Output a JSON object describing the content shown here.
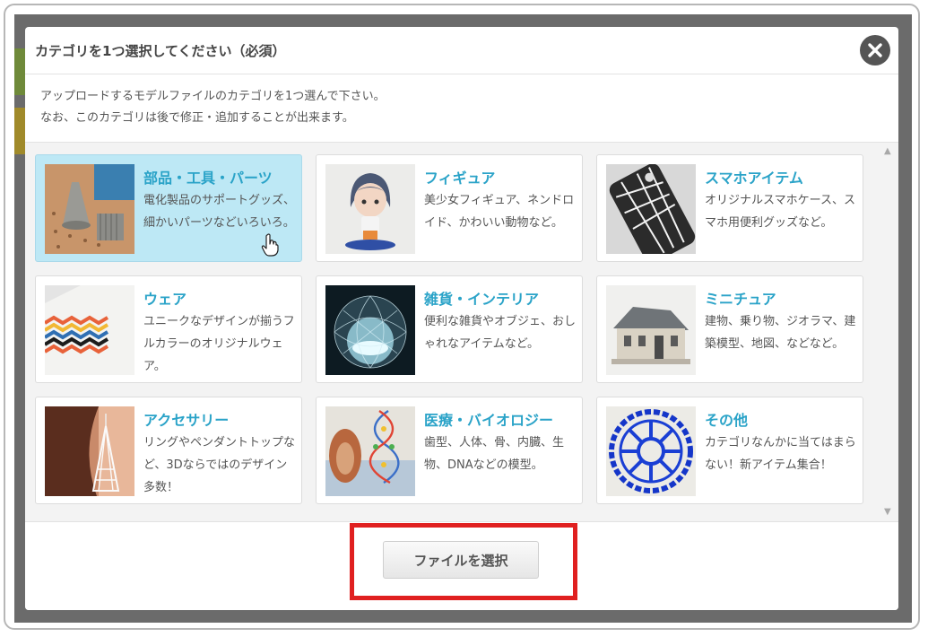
{
  "modal": {
    "title": "カテゴリを1つ選択してください（必須）",
    "intro_line1": "アップロードするモデルファイルのカテゴリを1つ選んで下さい。",
    "intro_line2": "なお、このカテゴリは後で修正・追加することが出来ます。",
    "close_icon": "close-icon"
  },
  "categories": [
    {
      "title": "部品・工具・パーツ",
      "desc": "電化製品のサポートグッズ、細かいパーツなどいろいろ。",
      "selected": true
    },
    {
      "title": "フィギュア",
      "desc": "美少女フィギュア、ネンドロイド、かわいい動物など。",
      "selected": false
    },
    {
      "title": "スマホアイテム",
      "desc": "オリジナルスマホケース、スマホ用便利グッズなど。",
      "selected": false
    },
    {
      "title": "ウェア",
      "desc": "ユニークなデザインが揃うフルカラーのオリジナルウェア。",
      "selected": false
    },
    {
      "title": "雑貨・インテリア",
      "desc": "便利な雑貨やオブジェ、おしゃれなアイテムなど。",
      "selected": false
    },
    {
      "title": "ミニチュア",
      "desc": "建物、乗り物、ジオラマ、建築模型、地図、などなど。",
      "selected": false
    },
    {
      "title": "アクセサリー",
      "desc": "リングやペンダントトップなど、3Dならではのデザイン多数！",
      "selected": false
    },
    {
      "title": "医療・バイオロジー",
      "desc": "歯型、人体、骨、内臓、生物、DNAなどの模型。",
      "selected": false
    },
    {
      "title": "その他",
      "desc": "カテゴリなんかに当てはまらない！新アイテム集合！",
      "selected": false
    }
  ],
  "footer": {
    "select_file_label": "ファイルを選択"
  },
  "accent_color": "#2aa3c8",
  "highlight_color": "#e02020"
}
